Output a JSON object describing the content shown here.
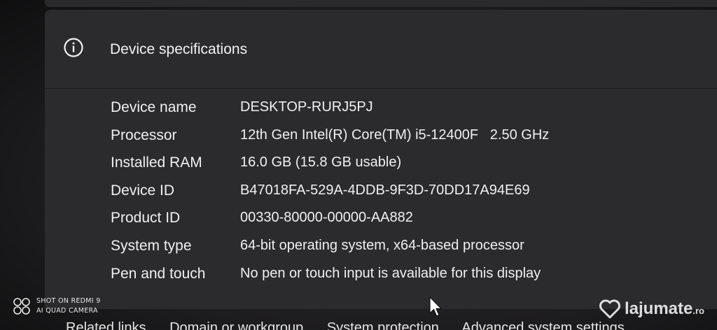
{
  "section": {
    "title": "Device specifications",
    "icon": "info-icon"
  },
  "specs": [
    {
      "label": "Device name",
      "value": "DESKTOP-RURJ5PJ"
    },
    {
      "label": "Processor",
      "value": "12th Gen Intel(R) Core(TM) i5-12400F   2.50 GHz"
    },
    {
      "label": "Installed RAM",
      "value": "16.0 GB (15.8 GB usable)"
    },
    {
      "label": "Device ID",
      "value": "B47018FA-529A-4DDB-9F3D-70DD17A94E69"
    },
    {
      "label": "Product ID",
      "value": "00330-80000-00000-AA882"
    },
    {
      "label": "System type",
      "value": "64-bit operating system, x64-based processor"
    },
    {
      "label": "Pen and touch",
      "value": "No pen or touch input is available for this display"
    }
  ],
  "related_links": [
    "Related links",
    "Domain or workgroup",
    "System protection",
    "Advanced system settings"
  ],
  "watermark": {
    "line1": "SHOT ON REDMI 9",
    "line2": "AI QUAD CAMERA",
    "brand": "lajumate",
    "brand_suffix": ".ro"
  }
}
